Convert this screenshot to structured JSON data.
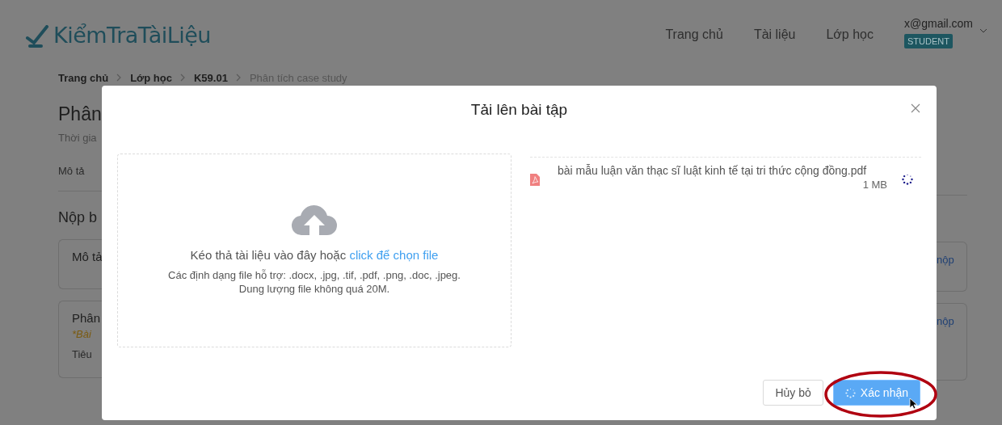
{
  "header": {
    "logo": "KiểmTraTàiLiệu",
    "nav": [
      {
        "label": "Trang chủ"
      },
      {
        "label": "Tài liệu"
      },
      {
        "label": "Lớp học"
      }
    ],
    "user": {
      "email": "x@gmail.com",
      "role": "STUDENT"
    }
  },
  "breadcrumb": [
    {
      "label": "Trang chủ",
      "current": false
    },
    {
      "label": "Lớp học",
      "current": false
    },
    {
      "label": "K59.01",
      "current": false
    },
    {
      "label": "Phân tích case study",
      "current": true
    }
  ],
  "background": {
    "title": "Phân",
    "subtitle": "Thời gia",
    "tab": "Mô tả",
    "section": "Nộp b",
    "cards": [
      {
        "title": "Mô tả",
        "action": "nộp"
      },
      {
        "title": "Phân",
        "note": "*Bài",
        "line": "Tiêu",
        "action": "nộp"
      }
    ]
  },
  "modal": {
    "title": "Tải lên bài tập",
    "dropzone": {
      "prompt": "Kéo thả tài liệu vào đây hoặc",
      "link": "click để chọn file",
      "formats": "Các định dạng file hỗ trợ: .docx, .jpg, .tif, .pdf, .png, .doc, .jpeg.",
      "limit": "Dung lượng file không quá 20M."
    },
    "files": [
      {
        "name": "bài mẫu luận văn thạc sĩ luật kinh tế tại tri thức cộng đồng.pdf",
        "size": "1 MB",
        "uploading": true
      }
    ],
    "buttons": [
      {
        "label": "Hủy bỏ",
        "kind": "default",
        "loading": false
      },
      {
        "label": "Xác nhận",
        "kind": "primary",
        "loading": true
      }
    ]
  }
}
